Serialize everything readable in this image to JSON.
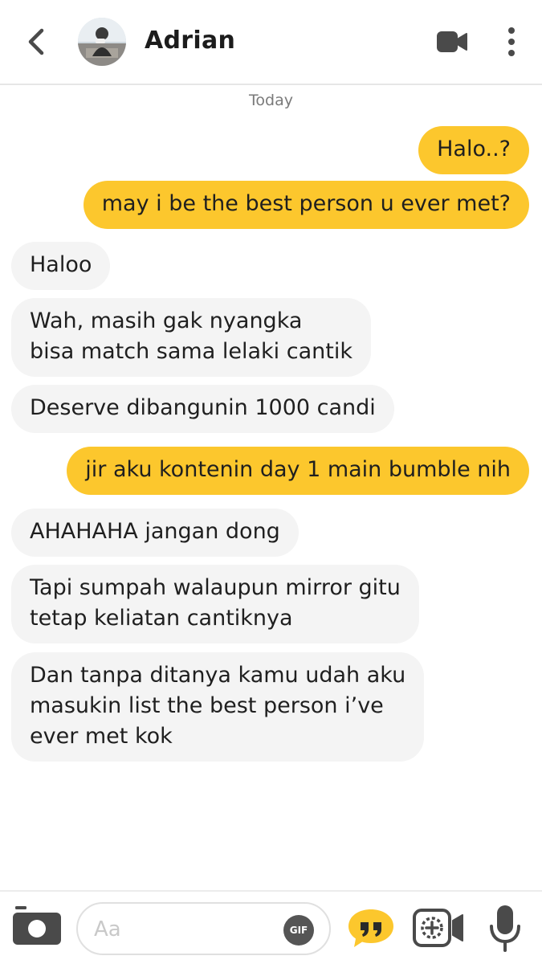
{
  "header": {
    "contact_name": "Adrian",
    "back_icon": "chevron-left-icon",
    "video_icon": "video-camera-icon",
    "more_icon": "more-vertical-icon"
  },
  "day_label": "Today",
  "messages": [
    {
      "direction": "out",
      "lines": [
        "Halo..?"
      ]
    },
    {
      "direction": "out",
      "lines": [
        "may i be the best person u ever met?"
      ]
    },
    {
      "direction": "in",
      "lines": [
        "Haloo"
      ]
    },
    {
      "direction": "in",
      "lines": [
        "Wah, masih gak nyangka",
        "bisa match sama lelaki cantik"
      ]
    },
    {
      "direction": "in",
      "lines": [
        "Deserve dibangunin 1000 candi"
      ]
    },
    {
      "direction": "out",
      "lines": [
        "jir aku kontenin day 1 main bumble nih"
      ]
    },
    {
      "direction": "in",
      "lines": [
        "AHAHAHA jangan dong"
      ]
    },
    {
      "direction": "in",
      "lines": [
        "Tapi sumpah walaupun mirror gitu",
        "tetap keliatan cantiknya"
      ]
    },
    {
      "direction": "in",
      "lines": [
        "Dan tanpa ditanya kamu udah aku",
        "masukin list the best person i’ve",
        "ever met kok"
      ]
    }
  ],
  "composer": {
    "placeholder": "Aa",
    "value": "",
    "gif_label": "GIF"
  },
  "colors": {
    "outgoing_bubble": "#fcc72d",
    "incoming_bubble": "#f4f4f4",
    "icon_dark": "#4a4a4a",
    "accent": "#fcc72d"
  }
}
